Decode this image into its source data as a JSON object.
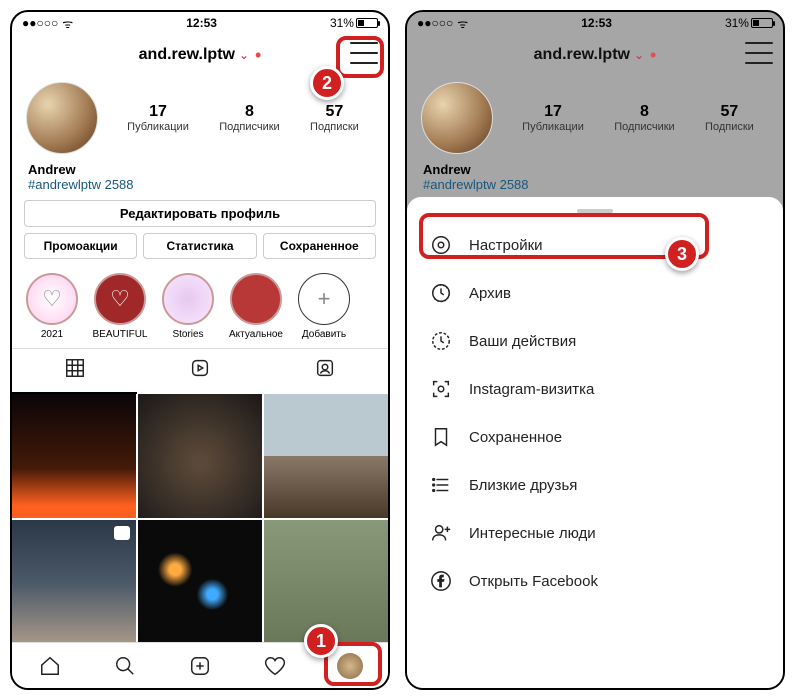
{
  "status": {
    "time": "12:53",
    "battery": "31%"
  },
  "header": {
    "username": "and.rew.lptw"
  },
  "stats": {
    "posts": {
      "n": "17",
      "l": "Публикации"
    },
    "followers": {
      "n": "8",
      "l": "Подписчики"
    },
    "following": {
      "n": "57",
      "l": "Подписки"
    }
  },
  "bio": {
    "name": "Andrew",
    "tag": "#andrewlptw 2588"
  },
  "buttons": {
    "edit": "Редактировать профиль",
    "promo": "Промоакции",
    "stat": "Статистика",
    "saved": "Сохраненное"
  },
  "highlights": [
    {
      "label": "2021"
    },
    {
      "label": "BEAUTIFUL"
    },
    {
      "label": "Stories"
    },
    {
      "label": "Актуальное"
    },
    {
      "label": "Добавить"
    }
  ],
  "menu": {
    "settings": "Настройки",
    "archive": "Архив",
    "activity": "Ваши действия",
    "qr": "Instagram-визитка",
    "saved": "Сохраненное",
    "close_friends": "Близкие друзья",
    "discover": "Интересные люди",
    "facebook": "Открыть Facebook"
  },
  "callouts": {
    "c1": "1",
    "c2": "2",
    "c3": "3"
  }
}
